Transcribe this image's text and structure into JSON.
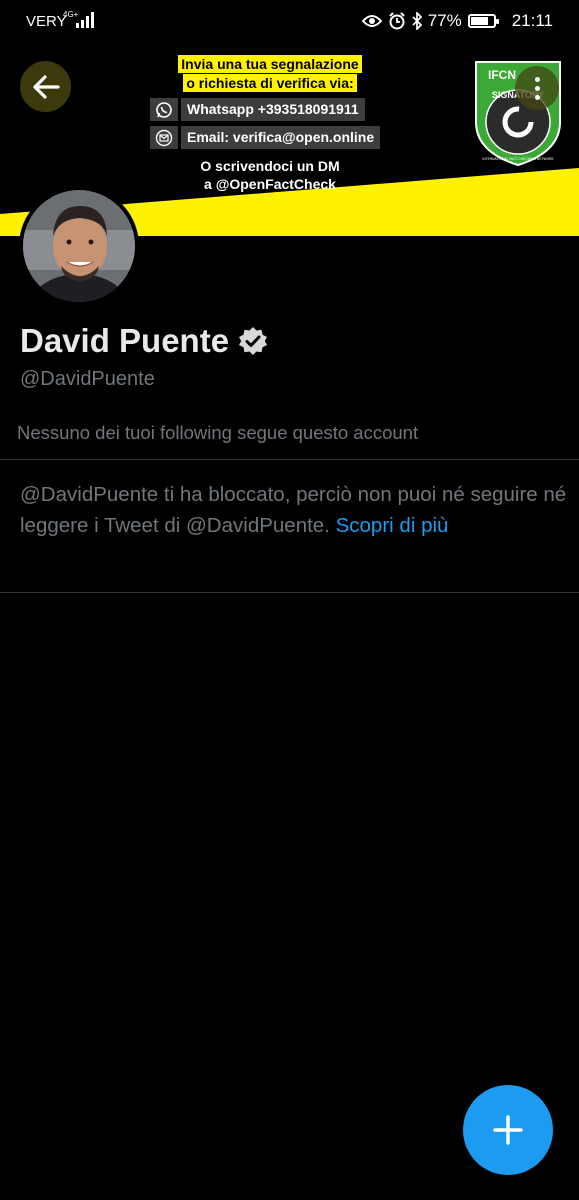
{
  "status_bar": {
    "carrier": "VERY",
    "network": "4G+",
    "battery": "77%",
    "battery_level": 0.77,
    "time": "21:11",
    "icons": [
      "signal-icon",
      "eye-icon",
      "alarm-icon",
      "bluetooth-icon",
      "battery-icon"
    ]
  },
  "banner": {
    "line1": "Invia una tua segnalazione",
    "line2": "o richiesta di verifica via:",
    "whatsapp": "Whatsapp +393518091911",
    "email": "Email: verifica@open.online",
    "dm_line1": "O scrivendoci un DM",
    "dm_line2": "a @OpenFactCheck",
    "badge_top": "IFCN",
    "badge_signatory": "SIGNATORY",
    "badge_network": "INTERNATIONAL FACT-CHECKING NETWORK",
    "accent": "#fff200"
  },
  "profile": {
    "name": "David Puente",
    "handle": "@DavidPuente",
    "following_note": "Nessuno dei tuoi following segue questo account",
    "blocked_text": "@DavidPuente ti ha bloccato, perciò non puoi né seguire né leggere i Tweet di @DavidPuente.",
    "learn_more": "Scopri di più",
    "verified_icon": "verified-badge-icon"
  },
  "colors": {
    "link": "#1d9bf0",
    "fab": "#1d9bf0",
    "muted": "#71767b",
    "text": "#e7e9ea"
  }
}
